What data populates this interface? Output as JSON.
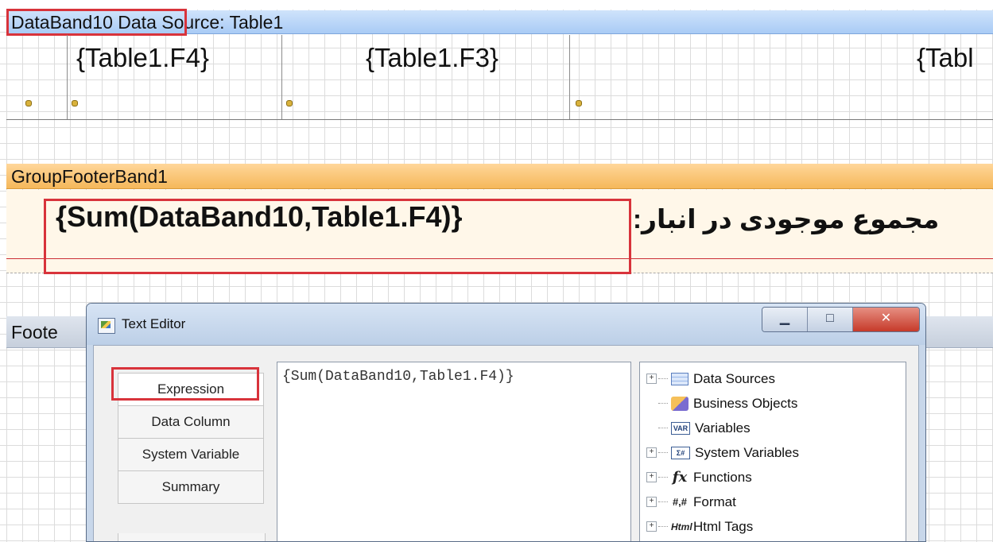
{
  "designer": {
    "databand_header": {
      "name": "DataBand10",
      "source": "Data Source: Table1"
    },
    "data_fields": [
      "{Table1.F4}",
      "{Table1.F3}",
      "{Tabl"
    ],
    "groupfooter_header": "GroupFooterBand1",
    "groupfooter_expression": "{Sum(DataBand10,Table1.F4)}",
    "groupfooter_label": "مجموع موجودی در انبار:",
    "footer_header": "Foote"
  },
  "dialog": {
    "title": "Text Editor",
    "buttons": {
      "minimize": "▁",
      "maximize": "□",
      "close": "✕"
    },
    "tabs": [
      "Expression",
      "Data Column",
      "System Variable",
      "Summary"
    ],
    "active_tab": "Expression",
    "editor_text": "{Sum(DataBand10,Table1.F4)}",
    "tree": [
      {
        "label": "Data Sources",
        "icon": "data-sources-icon",
        "expandable": true
      },
      {
        "label": "Business Objects",
        "icon": "business-objects-icon",
        "expandable": false
      },
      {
        "label": "Variables",
        "icon": "variables-icon",
        "icon_text": "VAR",
        "expandable": false
      },
      {
        "label": "System Variables",
        "icon": "system-variables-icon",
        "icon_text": "Σ#",
        "expandable": true
      },
      {
        "label": "Functions",
        "icon": "functions-icon",
        "icon_text": "fx",
        "expandable": true
      },
      {
        "label": "Format",
        "icon": "format-icon",
        "icon_text": "#,#",
        "expandable": true
      },
      {
        "label": "Html Tags",
        "icon": "html-tags-icon",
        "icon_text": "Html",
        "expandable": true
      }
    ]
  },
  "colors": {
    "highlight": "#d8333b",
    "databand": "#a9cbf5",
    "groupfooter": "#f5b85a"
  }
}
